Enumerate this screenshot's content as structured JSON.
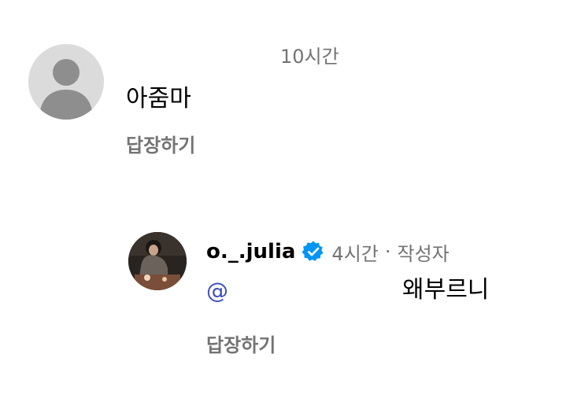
{
  "comment": {
    "time": "10시간",
    "text": "아줌마",
    "reply_label": "답장하기"
  },
  "reply": {
    "username": "o._.julia",
    "time": "4시간",
    "separator": "·",
    "author_badge": "작성자",
    "mention": "@",
    "text": "왜부르니",
    "reply_label": "답장하기"
  },
  "icons": {
    "default_avatar": "default-user-avatar",
    "verified": "verified-badge-icon"
  },
  "colors": {
    "secondary_text": "#737373",
    "mention": "#3f4dbf",
    "verified": "#0095f6"
  }
}
